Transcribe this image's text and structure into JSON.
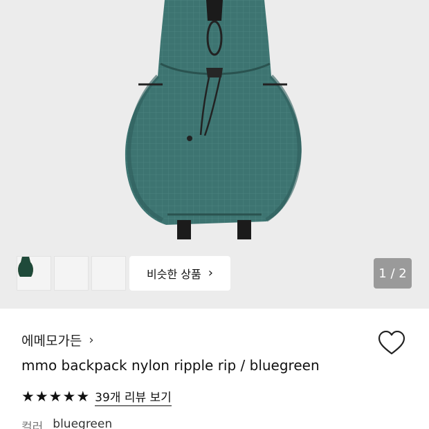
{
  "gallery": {
    "pager": "1 / 2",
    "similar_button": "비슷한 상품",
    "thumbnails": [
      {
        "color_name": "charcoal",
        "color": "#3a4247"
      },
      {
        "color_name": "beige",
        "color": "#d7a560"
      },
      {
        "color_name": "green",
        "color": "#1f4a3a"
      }
    ]
  },
  "product": {
    "brand": "에메모가든",
    "title": "mmo backpack nylon ripple rip / bluegreen",
    "rating_stars": 5,
    "reviews_link": "39개 리뷰 보기",
    "color_label": "컬러",
    "color_value": "bluegreen"
  },
  "colors": {
    "hero_bg": "#ececec",
    "backpack": "#3d7471",
    "backpack_shadow": "#2f5e5b",
    "pager_bg": "#9a9a9a"
  }
}
